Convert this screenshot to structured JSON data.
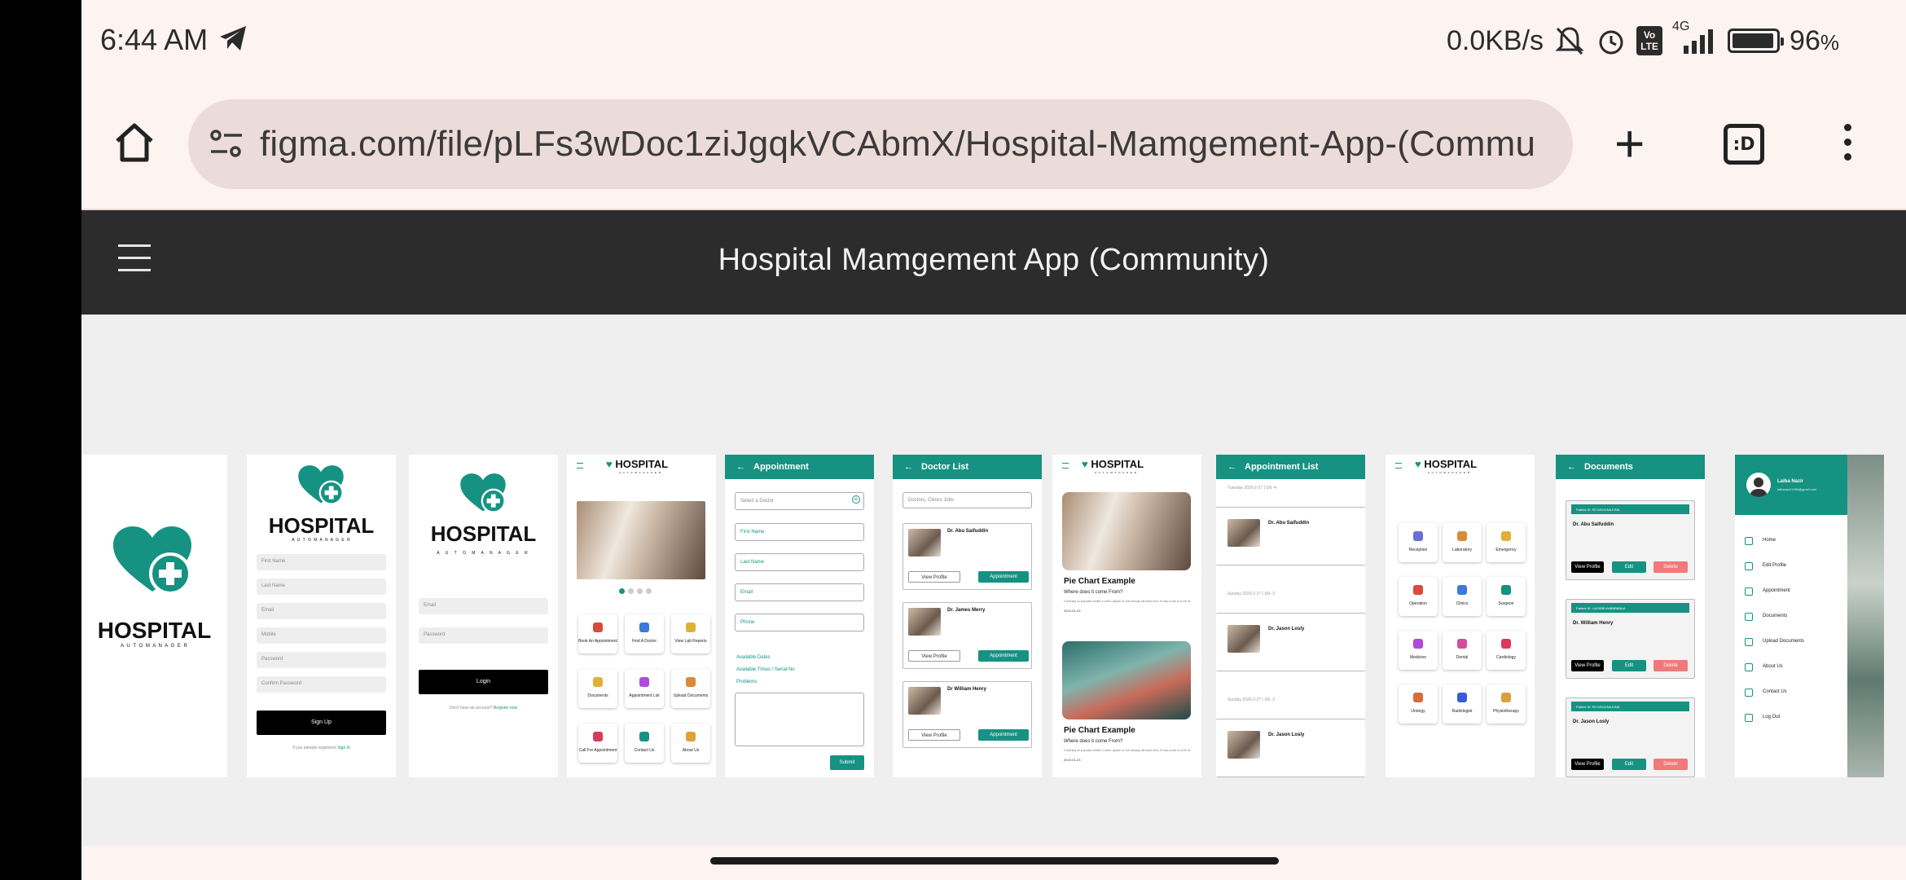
{
  "status_bar": {
    "time": "6:44 AM",
    "net_speed": "0.0KB/s",
    "network": "4G",
    "volte": "Vo LTE",
    "battery": "96",
    "battery_unit": "%",
    "battery_level": 0.96
  },
  "browser": {
    "url": "figma.com/file/pLFs3wDoc1ziJgqkVCAbmX/Hospital-Mamgement-App-(Commu",
    "tabs_label": ":D"
  },
  "figma": {
    "title": "Hospital Mamgement App (Community)"
  },
  "frames": {
    "splash": {
      "logo": "HOSPITAL",
      "tagline": "A U T O M A N A G E R"
    },
    "signup": {
      "logo": "HOSPITAL",
      "tagline": "A U T O M A N A G E R",
      "fields": [
        "First Name",
        "Last Name",
        "Email",
        "Mobile",
        "Password",
        "Confirm Password"
      ],
      "button": "Sign Up",
      "footer_text": "If you already registered",
      "footer_link": "Sign In"
    },
    "login": {
      "logo": "HOSPITAL",
      "tagline": "A U T O M A N A G E R",
      "fields": [
        "Email",
        "Password"
      ],
      "button": "Login",
      "footer_text": "Don't have an account?",
      "footer_link": "Register now"
    },
    "home": {
      "logo": "HOSPITAL",
      "tagline": "A U T O M A N A G E R",
      "tiles": [
        "Book An Appointment",
        "Find A Doctor",
        "View Lab Reports",
        "Documents",
        "Appointment List",
        "Upload Documents",
        "Call For Appointment",
        "Contact Us",
        "About Us"
      ]
    },
    "appointment": {
      "title": "Appointment",
      "select": "Select a Doctor",
      "fields": [
        "First Name",
        "Last Name",
        "Email",
        "Phone"
      ],
      "links": [
        "Available Dates",
        "Available Times / Serial No",
        "Problems"
      ],
      "button": "Submit"
    },
    "doctor_list": {
      "title": "Doctor List",
      "search": "Doctors, Clinics Jobs",
      "doctors": [
        {
          "name": "Dr. Abu Saifuddin"
        },
        {
          "name": "Dr. James Merry"
        },
        {
          "name": "Dr William Henry"
        }
      ],
      "view_label": "View Profile",
      "appt_label": "Appointment"
    },
    "news": {
      "logo": "HOSPITAL",
      "tagline": "A U T O M A N A G E R",
      "posts": [
        {
          "title": "Pie Chart Example",
          "sub": "Where does it come From?",
          "body": "Contrary to popular belief, Lorem Ipsum is not simply random text. It has roots in a bit of ...",
          "date": "2019-01-23"
        },
        {
          "title": "Pie Chart Example",
          "sub": "Where does it come From?",
          "body": "Contrary to popular belief, Lorem Ipsum is not simply random text. It has roots in a bit of ...",
          "date": "2019-01-23"
        }
      ]
    },
    "appointment_list": {
      "title": "Appointment List",
      "groups": [
        {
          "date": "Tuesday 2020-2-27 | SN -4",
          "doctor": "Dr. Abu Saifuddin"
        },
        {
          "date": "Sunday 2020-2-27 | SN -3",
          "doctor": "Dr. Jason Losly"
        },
        {
          "date": "Sunday 2020-2-27 | SN -3",
          "doctor": "Dr. Jason Losly"
        }
      ]
    },
    "departments": {
      "logo": "HOSPITAL",
      "tagline": "A U T O M A N A G E R",
      "items": [
        {
          "label": "Reception",
          "color": "#6a6fd6"
        },
        {
          "label": "Laboratory",
          "color": "#d98a3a"
        },
        {
          "label": "Emergency",
          "color": "#e0b03a"
        },
        {
          "label": "Operation",
          "color": "#d94a3a"
        },
        {
          "label": "Clinics",
          "color": "#3a7ad9"
        },
        {
          "label": "Surgeon",
          "color": "#169282"
        },
        {
          "label": "Medicine",
          "color": "#b04ad9"
        },
        {
          "label": "Dental",
          "color": "#d94a9a"
        },
        {
          "label": "Cardiology",
          "color": "#d93a5a"
        },
        {
          "label": "Urology",
          "color": "#d96a3a"
        },
        {
          "label": "Radiologist",
          "color": "#3a5ad9"
        },
        {
          "label": "Physiotherapy",
          "color": "#d9a03a"
        }
      ]
    },
    "documents": {
      "title": "Documents",
      "items": [
        {
          "patient": "Patient ID: RCV45JUNAJUNA",
          "doctor": "Dr. Abu Saifuddin"
        },
        {
          "patient": "Patient ID: LACKBEUMBBBBBAA",
          "doctor": "Dr. William Henry"
        },
        {
          "patient": "Patient ID: RCV45JUNAJUNA",
          "doctor": "Dr. Jason Losly"
        }
      ],
      "view_label": "View Profile",
      "edit_label": "Edit",
      "delete_label": "Delete"
    },
    "drawer": {
      "user_name": "Laiba Nazir",
      "user_email": "laibanazir1999@gmail.com",
      "items": [
        "Home",
        "Edit Profile",
        "Appointment",
        "Documents",
        "Upload Documents",
        "About Us",
        "Contact Us",
        "Log Out"
      ]
    }
  }
}
